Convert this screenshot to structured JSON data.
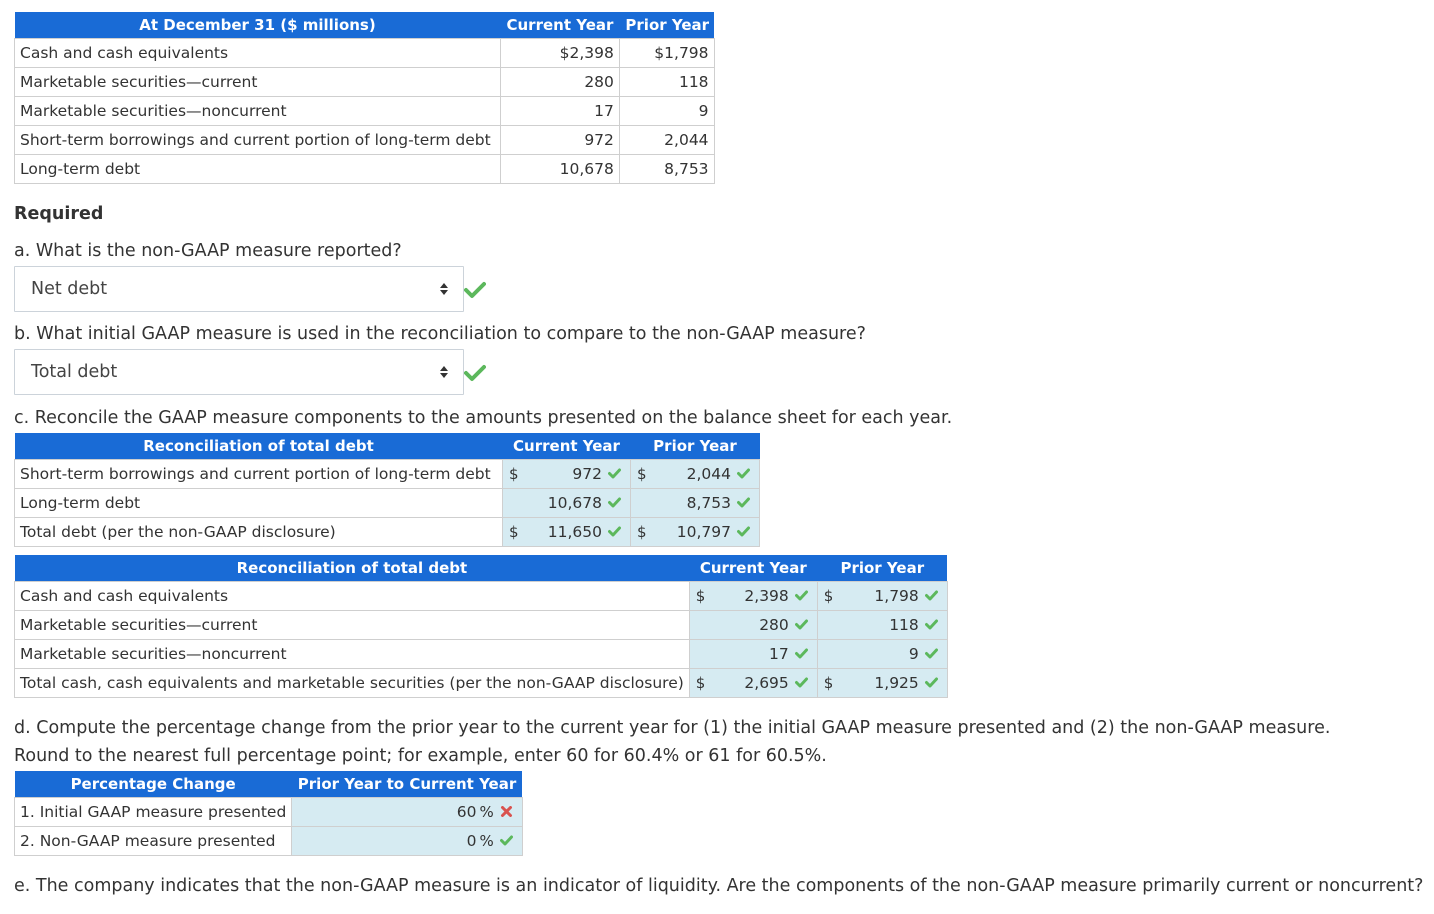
{
  "balance_table": {
    "headers": [
      "At December 31 ($ millions)",
      "Current Year",
      "Prior Year"
    ],
    "rows": [
      {
        "label": "Cash and cash equivalents",
        "current": "$2,398",
        "prior": "$1,798"
      },
      {
        "label": "Marketable securities—current",
        "current": "280",
        "prior": "118"
      },
      {
        "label": "Marketable securities—noncurrent",
        "current": "17",
        "prior": "9"
      },
      {
        "label": "Short-term borrowings and current portion of long-term debt",
        "current": "972",
        "prior": "2,044"
      },
      {
        "label": "Long-term debt",
        "current": "10,678",
        "prior": "8,753"
      }
    ]
  },
  "required_heading": "Required",
  "part_a": {
    "question": "a. What is the non-GAAP measure reported?",
    "selected": "Net debt",
    "status": "correct"
  },
  "part_b": {
    "question": "b. What initial GAAP measure is used in the reconciliation to compare to the non-GAAP measure?",
    "selected": "Total debt",
    "status": "correct"
  },
  "part_c": {
    "question": "c. Reconcile the GAAP measure components to the amounts presented on the balance sheet for each year.",
    "debt_table": {
      "headers": [
        "Reconciliation of total debt",
        "Current Year",
        "Prior Year"
      ],
      "rows": [
        {
          "label": "Short-term borrowings and current portion of long-term debt",
          "cur_dollar": "$",
          "current": "972",
          "cur_status": "correct",
          "pri_dollar": "$",
          "prior": "2,044",
          "pri_status": "correct"
        },
        {
          "label": "Long-term debt",
          "cur_dollar": "",
          "current": "10,678",
          "cur_status": "correct",
          "pri_dollar": "",
          "prior": "8,753",
          "pri_status": "correct"
        },
        {
          "label": "Total debt (per the non-GAAP disclosure)",
          "cur_dollar": "$",
          "current": "11,650",
          "cur_status": "correct",
          "pri_dollar": "$",
          "prior": "10,797",
          "pri_status": "correct"
        }
      ]
    },
    "cash_table": {
      "headers": [
        "Reconciliation of total debt",
        "Current Year",
        "Prior Year"
      ],
      "rows": [
        {
          "label": "Cash and cash equivalents",
          "cur_dollar": "$",
          "current": "2,398",
          "cur_status": "correct",
          "pri_dollar": "$",
          "prior": "1,798",
          "pri_status": "correct"
        },
        {
          "label": "Marketable securities—current",
          "cur_dollar": "",
          "current": "280",
          "cur_status": "correct",
          "pri_dollar": "",
          "prior": "118",
          "pri_status": "correct"
        },
        {
          "label": "Marketable securities—noncurrent",
          "cur_dollar": "",
          "current": "17",
          "cur_status": "correct",
          "pri_dollar": "",
          "prior": "9",
          "pri_status": "correct"
        },
        {
          "label": "Total cash, cash equivalents and marketable securities (per the non-GAAP disclosure)",
          "cur_dollar": "$",
          "current": "2,695",
          "cur_status": "correct",
          "pri_dollar": "$",
          "prior": "1,925",
          "pri_status": "correct"
        }
      ]
    }
  },
  "part_d": {
    "question_line1": "d. Compute the percentage change from the prior year to the current year for (1) the initial GAAP measure presented and (2) the non-GAAP measure.",
    "question_line2": "Round to the nearest full percentage point; for example, enter 60 for 60.4% or 61 for 60.5%.",
    "table": {
      "headers": [
        "Percentage Change",
        "Prior Year to Current Year"
      ],
      "rows": [
        {
          "label": "1. Initial GAAP measure presented",
          "value": "60",
          "unit": "%",
          "status": "incorrect"
        },
        {
          "label": "2. Non-GAAP measure presented",
          "value": "0",
          "unit": "%",
          "status": "correct"
        }
      ]
    }
  },
  "part_e": {
    "question": "e. The company indicates that the non-GAAP measure is an indicator of liquidity. Are the components of the non-GAAP measure primarily current or noncurrent?"
  },
  "colors": {
    "header_blue": "#196bd6",
    "input_cell_bg": "#d6ebf2",
    "correct_green": "#5cb85c",
    "incorrect_red": "#d9534f"
  }
}
